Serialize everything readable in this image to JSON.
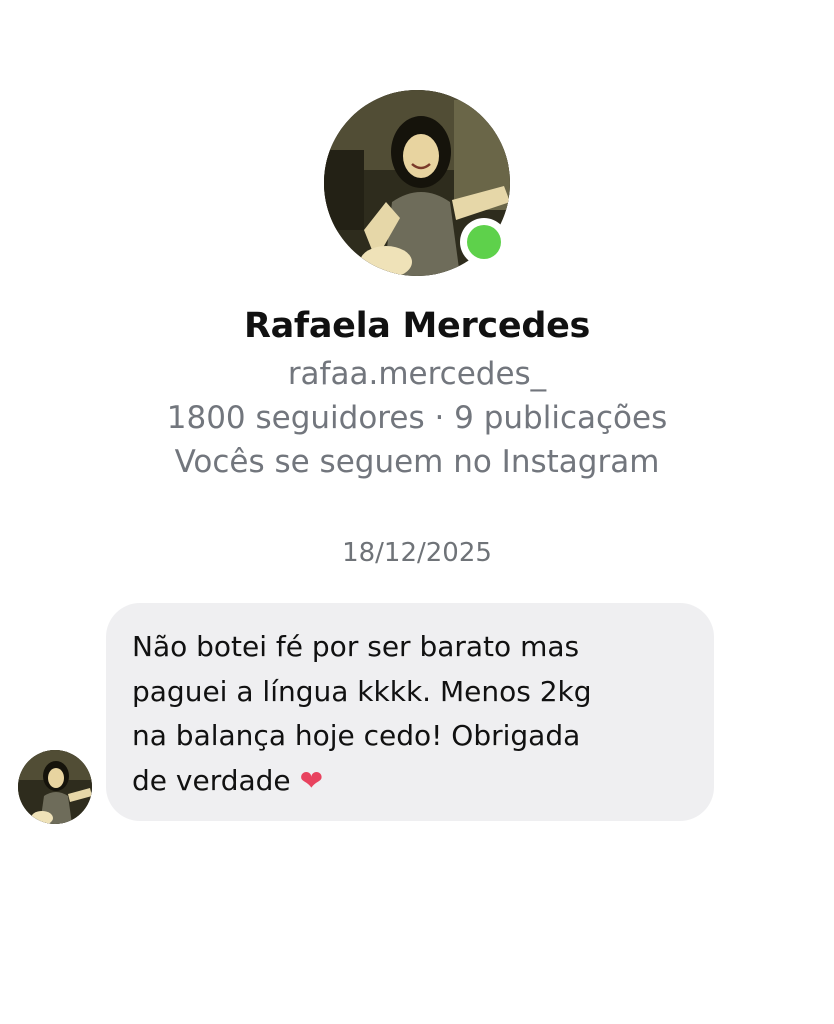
{
  "profile": {
    "name": "Rafaela Mercedes",
    "username": "rafaa.mercedes_",
    "stats": "1800 seguidores · 9 publicações",
    "mutual": "Vocês se seguem no Instagram",
    "online_color": "#5ed14b"
  },
  "thread": {
    "date": "18/12/2025",
    "messages": [
      {
        "text": "Não botei fé por ser barato mas\npaguei a língua kkkk. Menos 2kg\nna balança hoje cedo! Obrigada\nde verdade ",
        "emoji": "❤",
        "bubble_color": "#efeff1"
      }
    ]
  }
}
